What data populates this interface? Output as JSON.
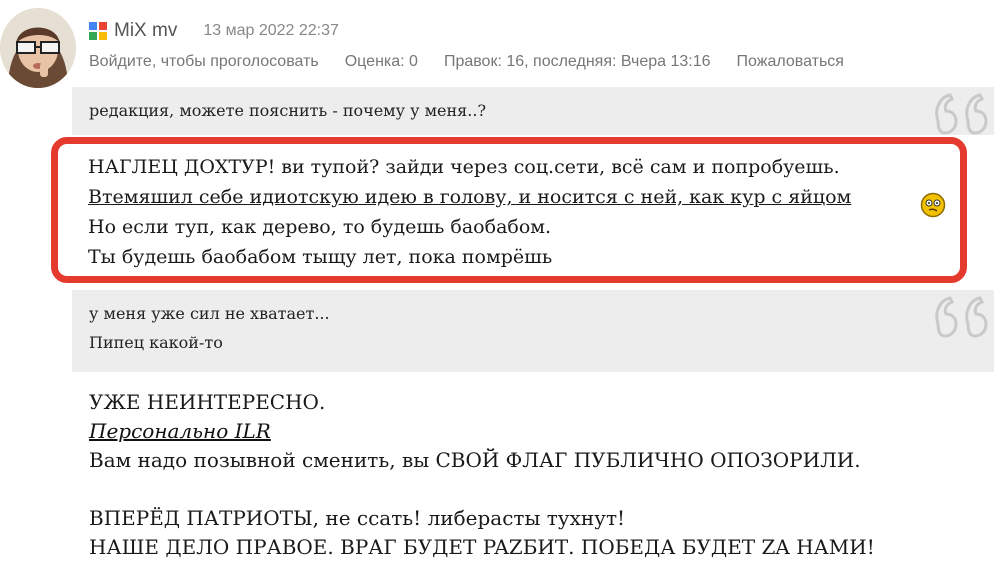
{
  "comment": {
    "author": "MiX mv",
    "date": "13 мар 2022 22:37",
    "actions": {
      "vote": "Войдите, чтобы проголосовать",
      "rating": "Оценка: 0",
      "edits": "Правок: 16, последняя: Вчера 13:16",
      "report": "Пожаловаться"
    },
    "quote1": {
      "line1": "редакция, можете пояснить - почему у меня..?"
    },
    "highlight": {
      "line1": "НАГЛЕЦ ДОХТУР! ви тупой? зайди через соц.сети, всё сам и попробуешь.",
      "line2": "Втемяшил себе идиотскую идею в голову, и носится с ней, как кур с яйцом",
      "line3": "Но если туп, как дерево, то будешь баобабом.",
      "line4": "Ты будешь баобабом тыщу лет, пока помрёшь"
    },
    "quote2": {
      "line1": "у меня уже сил не хватает...",
      "line2": "Пипец какой-то"
    },
    "body": {
      "line1": "УЖЕ  НЕИНТЕРЕСНО.",
      "link": "Персонально ILR",
      "line3": "Вам надо позывной сменить, вы  СВОЙ  ФЛАГ  ПУБЛИЧНО  ОПОЗОРИЛИ.",
      "line4": "ВПЕРЁД ПАТРИОТЫ,  не ссать! либерасты тухнут!",
      "line5": "НАШЕ  ДЕЛО  ПРАВOE. ВРАГ  БУДЕТ  PAZБИТ.  ПОБЕДА  БУДЕТ  ZA  НАМИ!"
    }
  },
  "colors": {
    "highlight_border": "#e53b2f",
    "quote_bg": "#ededed",
    "meta_text": "#777777"
  }
}
